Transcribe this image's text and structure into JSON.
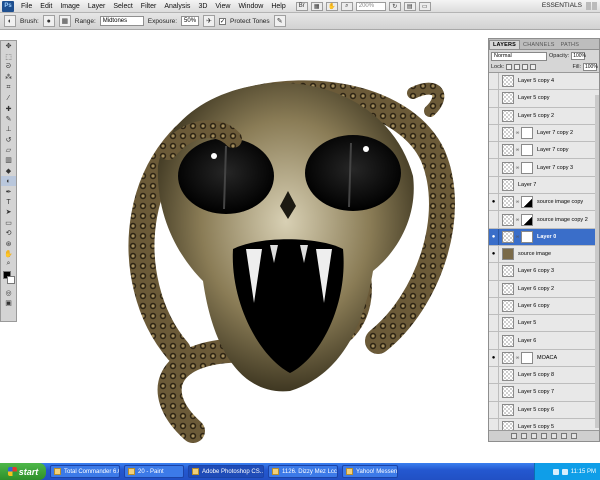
{
  "menubar": {
    "logo": "Ps",
    "items": [
      "File",
      "Edit",
      "Image",
      "Layer",
      "Select",
      "Filter",
      "Analysis",
      "3D",
      "View",
      "Window",
      "Help"
    ],
    "zoom": "200%",
    "workspace": "ESSENTIALS"
  },
  "options": {
    "brush_label": "Brush:",
    "range_label": "Range:",
    "range_value": "Midtones",
    "exposure_label": "Exposure:",
    "exposure_value": "50%",
    "protect_label": "Protect Tones",
    "protect_checked": "✓"
  },
  "layers_panel": {
    "tabs": [
      "LAYERS",
      "CHANNELS",
      "PATHS"
    ],
    "blend_mode": "Normal",
    "opacity_label": "Opacity:",
    "opacity_value": "100%",
    "lock_label": "Lock:",
    "fill_label": "Fill:",
    "fill_value": "100%",
    "layers": [
      {
        "name": "Layer 5 copy 4",
        "visible": "",
        "mask": "none",
        "selected": false,
        "thumb": "empty"
      },
      {
        "name": "Layer 5 copy",
        "visible": "",
        "mask": "none",
        "selected": false,
        "thumb": "empty"
      },
      {
        "name": "Layer 5 copy 2",
        "visible": "",
        "mask": "none",
        "selected": false,
        "thumb": "empty"
      },
      {
        "name": "Layer 7 copy 2",
        "visible": "",
        "mask": "white",
        "selected": false,
        "thumb": "empty"
      },
      {
        "name": "Layer 7 copy",
        "visible": "",
        "mask": "white",
        "selected": false,
        "thumb": "empty"
      },
      {
        "name": "Layer 7 copy 3",
        "visible": "",
        "mask": "white",
        "selected": false,
        "thumb": "empty"
      },
      {
        "name": "Layer 7",
        "visible": "",
        "mask": "none",
        "selected": false,
        "thumb": "empty"
      },
      {
        "name": "source image copy",
        "visible": "●",
        "mask": "dark",
        "selected": false,
        "thumb": "empty"
      },
      {
        "name": "source image copy 2",
        "visible": "",
        "mask": "dark",
        "selected": false,
        "thumb": "empty"
      },
      {
        "name": "Layer 0",
        "visible": "●",
        "mask": "white",
        "selected": true,
        "thumb": "empty"
      },
      {
        "name": "source image",
        "visible": "●",
        "mask": "none",
        "selected": false,
        "thumb": "filled"
      },
      {
        "name": "Layer 6 copy 3",
        "visible": "",
        "mask": "none",
        "selected": false,
        "thumb": "empty"
      },
      {
        "name": "Layer 6 copy 2",
        "visible": "",
        "mask": "none",
        "selected": false,
        "thumb": "empty"
      },
      {
        "name": "Layer 6 copy",
        "visible": "",
        "mask": "none",
        "selected": false,
        "thumb": "empty"
      },
      {
        "name": "Layer 5",
        "visible": "",
        "mask": "none",
        "selected": false,
        "thumb": "empty"
      },
      {
        "name": "Layer 6",
        "visible": "",
        "mask": "none",
        "selected": false,
        "thumb": "empty"
      },
      {
        "name": "MOACA",
        "visible": "●",
        "mask": "white",
        "selected": false,
        "thumb": "empty"
      },
      {
        "name": "Layer 5 copy 8",
        "visible": "",
        "mask": "none",
        "selected": false,
        "thumb": "empty"
      },
      {
        "name": "Layer 5 copy 7",
        "visible": "",
        "mask": "none",
        "selected": false,
        "thumb": "empty"
      },
      {
        "name": "Layer 5 copy 6",
        "visible": "",
        "mask": "none",
        "selected": false,
        "thumb": "empty"
      },
      {
        "name": "Layer 5 copy 5",
        "visible": "",
        "mask": "none",
        "selected": false,
        "thumb": "empty"
      }
    ]
  },
  "tools": [
    "move",
    "marquee",
    "lasso",
    "quick-select",
    "crop",
    "eyedropper",
    "healing",
    "brush",
    "stamp",
    "history-brush",
    "eraser",
    "gradient",
    "blur",
    "dodge",
    "pen",
    "type",
    "path-select",
    "shape",
    "3d-rotate",
    "3d-orbit",
    "hand",
    "zoom"
  ],
  "taskbar": {
    "start": "start",
    "tasks": [
      "Total Commander 6.0...",
      "20 - Paint",
      "Adobe Photoshop CS...",
      "1126. Dizzy Mez Lcc...",
      "Yahoo! Messenger"
    ],
    "active_task": 2,
    "clock": "11:15 PM"
  },
  "colors": {
    "selected_layer": "#3a6ec9",
    "taskbar": "#2458d0",
    "start_button": "#2e8f2a"
  }
}
